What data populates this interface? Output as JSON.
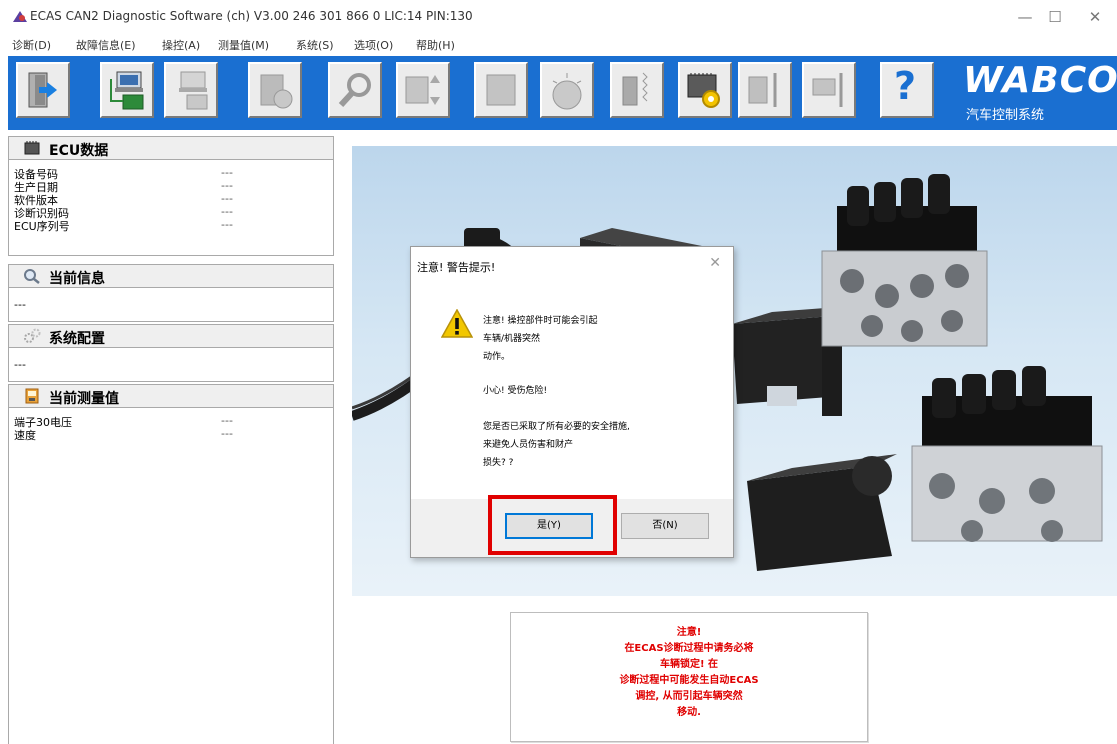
{
  "window": {
    "title": "ECAS CAN2 Diagnostic Software (ch) V3.00  246 301 866 0  LIC:14 PIN:130",
    "minimize": "—",
    "maximize": "☐",
    "close": "✕"
  },
  "menu": [
    {
      "label": "诊断(D)"
    },
    {
      "label": "故障信息(E)"
    },
    {
      "label": "操控(A)"
    },
    {
      "label": "测量值(M)"
    },
    {
      "label": "系统(S)"
    },
    {
      "label": "选项(O)"
    },
    {
      "label": "帮助(H)"
    }
  ],
  "toolbar": {
    "help_symbol": "?",
    "brand": "WABCO",
    "brand_sub": "汽车控制系统",
    "buttons": [
      {
        "icon": "exit-door-icon"
      },
      {
        "icon": "ecu-connect-icon"
      },
      {
        "icon": "disconnect-icon"
      },
      {
        "icon": "module-icon"
      },
      {
        "icon": "search-icon"
      },
      {
        "icon": "measure-transfer-icon"
      },
      {
        "icon": "device-icon"
      },
      {
        "icon": "gauge-icon"
      },
      {
        "icon": "sensor-icon"
      },
      {
        "icon": "ecu-settings-icon"
      },
      {
        "icon": "calibration-icon"
      },
      {
        "icon": "valve-icon"
      },
      {
        "icon": "help-icon"
      }
    ]
  },
  "left_panel": {
    "ecu_data": {
      "title": "ECU数据",
      "rows": [
        {
          "label": "设备号码",
          "value": "---"
        },
        {
          "label": "生产日期",
          "value": "---"
        },
        {
          "label": "软件版本",
          "value": "---"
        },
        {
          "label": "诊断识别码",
          "value": "---"
        },
        {
          "label": "ECU序列号",
          "value": "---"
        }
      ]
    },
    "current_info": {
      "title": "当前信息",
      "value": "---"
    },
    "system_config": {
      "title": "系统配置",
      "value": "---"
    },
    "measurements": {
      "title": "当前测量值",
      "rows": [
        {
          "label": "端子30电压",
          "value": "---"
        },
        {
          "label": "速度",
          "value": "---"
        }
      ]
    }
  },
  "notice": {
    "lines": [
      "注意!",
      "在ECAS诊断过程中请务必将",
      "车辆锁定! 在",
      "诊断过程中可能发生自动ECAS",
      "调控, 从而引起车辆突然",
      "移动."
    ]
  },
  "dialog": {
    "title": "注意! 警告提示!",
    "close": "✕",
    "lines": [
      "注意! 操控部件时可能会引起",
      "车辆/机器突然",
      "动作。",
      "小心! 受伤危险!",
      "您是否已采取了所有必要的安全措施,",
      "来避免人员伤害和财产",
      "损失? ?"
    ],
    "yes_label": "是(Y)",
    "no_label": "否(N)"
  },
  "colors": {
    "toolbar_bg": "#1a6fd1",
    "highlight": "#e00000",
    "notice_text": "#e00000"
  }
}
